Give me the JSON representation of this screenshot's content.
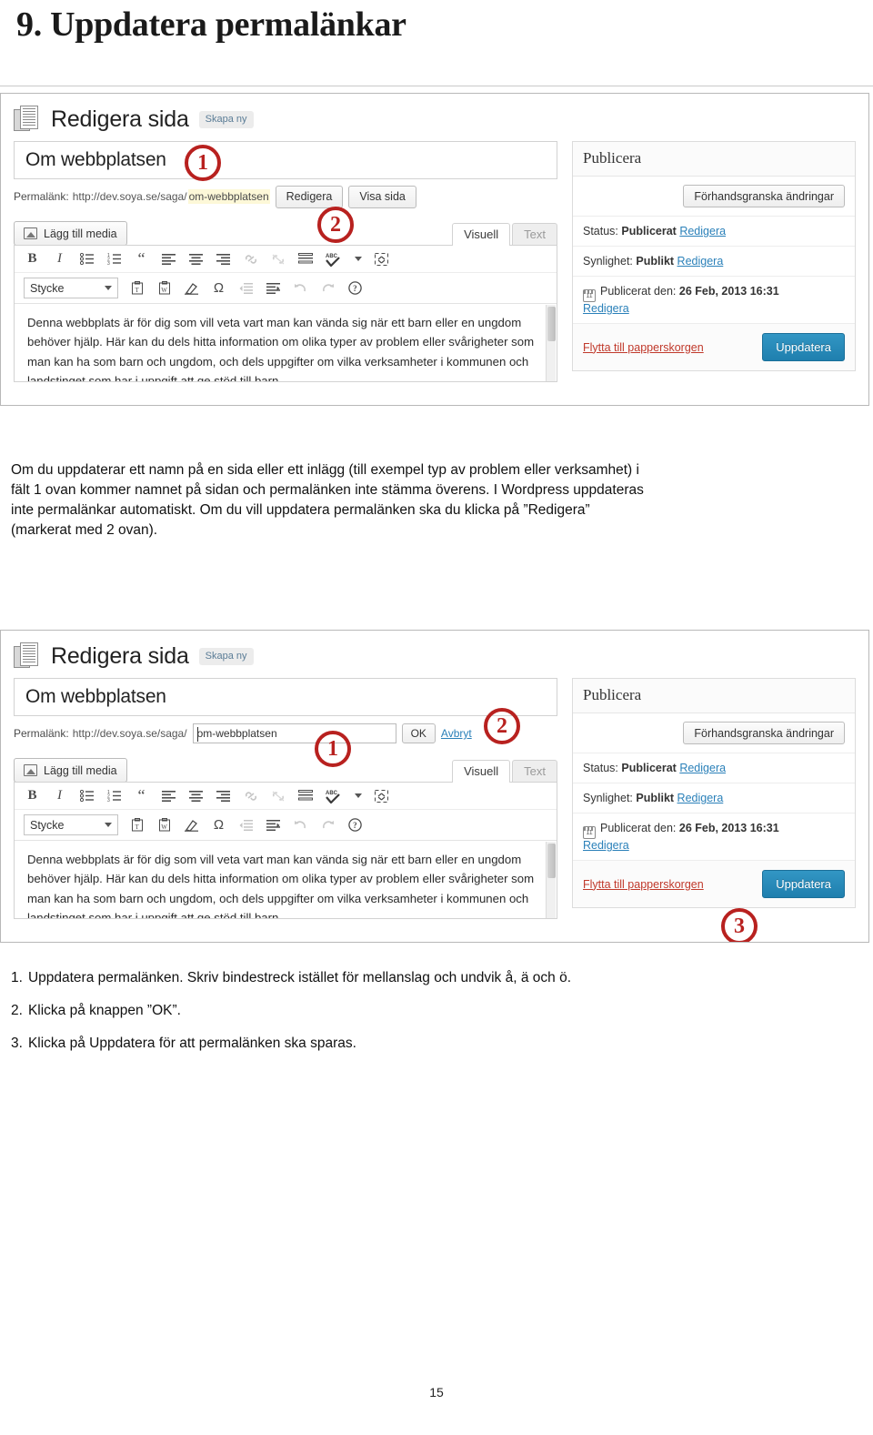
{
  "document": {
    "heading": "9. Uppdatera permalänkar",
    "page_number": "15"
  },
  "screenshot_1": {
    "header": {
      "page_icon": "pages-icon",
      "title": "Redigera sida",
      "new_badge": "Skapa ny"
    },
    "post_title": "Om webbplatsen",
    "permalink": {
      "label": "Permalänk:",
      "base_url": "http://dev.soya.se/saga/",
      "slug": "om-webbplatsen",
      "edit_button": "Redigera",
      "view_button": "Visa sida"
    },
    "media_button": "Lägg till media",
    "tabs": {
      "visual": "Visuell",
      "text": "Text"
    },
    "toolbar": {
      "format_select": "Stycke",
      "icons_row1": [
        "bold-icon",
        "italic-icon",
        "unordered-list-icon",
        "ordered-list-icon",
        "blockquote-icon",
        "align-left-icon",
        "align-center-icon",
        "align-right-icon",
        "insert-link-icon",
        "unlink-icon",
        "more-tag-icon",
        "spellcheck-icon",
        "spellcheck-dropdown-icon",
        "fullscreen-icon"
      ],
      "icons_row2": [
        "paste-as-text-icon",
        "paste-from-word-icon",
        "remove-formatting-icon",
        "special-character-icon",
        "outdent-icon",
        "indent-icon",
        "undo-icon",
        "redo-icon",
        "help-icon"
      ]
    },
    "editor_content": "Denna webbplats är för dig som vill veta vart man kan vända sig när ett barn eller en ungdom behöver hjälp. Här kan du dels hitta information om olika typer av problem eller svårigheter som man kan ha som barn och ungdom, och dels uppgifter om vilka verksamheter i kommunen och landstinget som har i uppgift att ge stöd till barn,",
    "publish_panel": {
      "heading": "Publicera",
      "preview_button": "Förhandsgranska ändringar",
      "status_label": "Status:",
      "status_value": "Publicerat",
      "status_edit": "Redigera",
      "visibility_label": "Synlighet:",
      "visibility_value": "Publikt",
      "visibility_edit": "Redigera",
      "published_label": "Publicerat den:",
      "published_value": "26 Feb, 2013 16:31",
      "published_edit": "Redigera",
      "trash_link": "Flytta till papperskorgen",
      "update_button": "Uppdatera"
    },
    "annotations": [
      {
        "number": "1",
        "target": "post-title-field"
      },
      {
        "number": "2",
        "target": "permalink-edit-button"
      }
    ]
  },
  "screenshot_2": {
    "header": {
      "page_icon": "pages-icon",
      "title": "Redigera sida",
      "new_badge": "Skapa ny"
    },
    "post_title": "Om webbplatsen",
    "permalink": {
      "label": "Permalänk:",
      "base_url": "http://dev.soya.se/saga/",
      "slug_input_value": "om-webbplatsen",
      "ok_button": "OK",
      "cancel_link": "Avbryt"
    },
    "media_button": "Lägg till media",
    "tabs": {
      "visual": "Visuell",
      "text": "Text"
    },
    "toolbar": {
      "format_select": "Stycke"
    },
    "editor_content": "Denna webbplats är för dig som vill veta vart man kan vända sig när ett barn eller en ungdom behöver hjälp. Här kan du dels hitta information om olika typer av problem eller svårigheter som man kan ha som barn och ungdom, och dels uppgifter om vilka verksamheter i kommunen och landstinget som har i uppgift att ge stöd till barn,",
    "publish_panel": {
      "heading": "Publicera",
      "preview_button": "Förhandsgranska ändringar",
      "status_label": "Status:",
      "status_value": "Publicerat",
      "status_edit": "Redigera",
      "visibility_label": "Synlighet:",
      "visibility_value": "Publikt",
      "visibility_edit": "Redigera",
      "published_label": "Publicerat den:",
      "published_value": "26 Feb, 2013 16:31",
      "published_edit": "Redigera",
      "trash_link": "Flytta till papperskorgen",
      "update_button": "Uppdatera"
    },
    "annotations": [
      {
        "number": "1",
        "target": "permalink-slug-input"
      },
      {
        "number": "2",
        "target": "permalink-cancel-link"
      },
      {
        "number": "3",
        "target": "update-button"
      }
    ]
  },
  "paragraph_1": "Om du uppdaterar ett namn på en sida eller ett inlägg (till exempel typ av problem eller verksamhet) i fält 1 ovan kommer namnet på sidan och permalänken inte stämma överens. I Wordpress uppdateras inte permalänkar automatiskt. Om du vill uppdatera permalänken ska du klicka på ”Redigera” (markerat med 2 ovan).",
  "steps": [
    {
      "num": "1.",
      "text": "Uppdatera permalänken. Skriv bindestreck istället för mellanslag och undvik å, ä och ö."
    },
    {
      "num": "2.",
      "text": "Klicka på knappen ”OK”."
    },
    {
      "num": "3.",
      "text": "Klicka på Uppdatera för att permalänken ska sparas."
    }
  ],
  "colors": {
    "annotation_red": "#b8211f",
    "update_button_blue": "#2585b2",
    "link_blue": "#2a80b9",
    "trash_red": "#c0392b",
    "permalink_highlight": "#fdf8d8"
  }
}
